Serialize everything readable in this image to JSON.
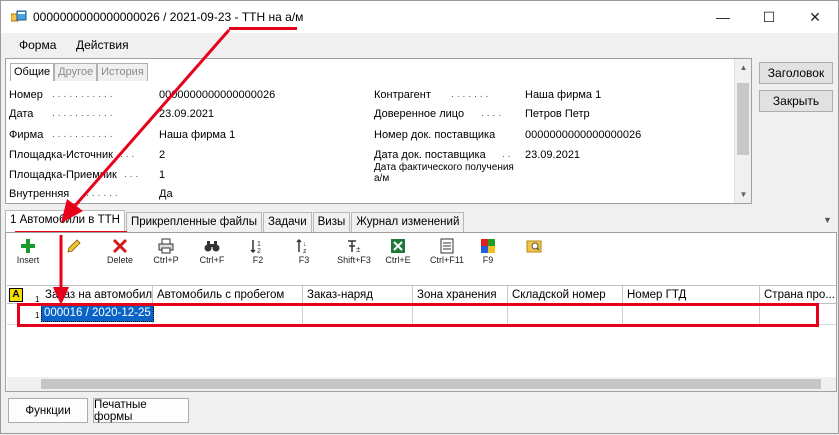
{
  "window": {
    "title": "0000000000000000026 / 2021-09-23 - ТТН на а/м",
    "minimize": "—",
    "maximize": "☐",
    "close": "✕"
  },
  "menu": {
    "items": [
      "Форма",
      "Действия"
    ]
  },
  "header_tabs": [
    "Общие",
    "Другое",
    "История"
  ],
  "fields_left": [
    {
      "label": "Номер",
      "value": "0000000000000000026"
    },
    {
      "label": "Дата",
      "value": "23.09.2021"
    },
    {
      "label": "Фирма",
      "value": "Наша фирма 1"
    },
    {
      "label": "Площадка-Источник",
      "value": "2"
    },
    {
      "label": "Площадка-Приемник",
      "value": "1"
    },
    {
      "label": "Внутренняя",
      "value": "Да"
    }
  ],
  "fields_right": [
    {
      "label": "Контрагент",
      "value": "Наша фирма 1"
    },
    {
      "label": "Доверенное лицо",
      "value": "Петров Петр"
    },
    {
      "label": "Номер док. поставщика",
      "value": "0000000000000000026"
    },
    {
      "label": "Дата док. поставщика",
      "value": "23.09.2021"
    },
    {
      "label": "Дата фактического получения а/м",
      "value": ""
    }
  ],
  "side_buttons": {
    "header": "Заголовок",
    "close": "Закрыть"
  },
  "tabs": [
    "1 Автомобили в ТТН",
    "Прикрепленные файлы",
    "Задачи",
    "Визы",
    "Журнал изменений"
  ],
  "toolbar": [
    {
      "icon": "plus-icon",
      "label": "Insert"
    },
    {
      "icon": "pencil-icon",
      "label": ""
    },
    {
      "icon": "delete-x-icon",
      "label": "Delete"
    },
    {
      "icon": "printer-icon",
      "label": "Ctrl+P"
    },
    {
      "icon": "binoculars-icon",
      "label": "Ctrl+F"
    },
    {
      "icon": "sort-icon",
      "label": "F2"
    },
    {
      "icon": "sort-desc-icon",
      "label": "F3"
    },
    {
      "icon": "filter-icon",
      "label": "Shift+F3"
    },
    {
      "icon": "excel-icon",
      "label": "Ctrl+E"
    },
    {
      "icon": "document-icon",
      "label": "Ctrl+F11"
    },
    {
      "icon": "color-grid-icon",
      "label": "F9"
    },
    {
      "icon": "search-folder-icon",
      "label": ""
    }
  ],
  "grid": {
    "corner": "A",
    "columns": [
      "Заказ на автомобиль",
      "Автомобиль с пробегом",
      "Заказ-наряд",
      "Зона хранения",
      "Складской номер",
      "Номер ГТД",
      "Страна про..."
    ],
    "header_row_marker": "1",
    "rows": [
      {
        "num": "1",
        "cells": [
          "000016 / 2020-12-25",
          "",
          "",
          "",
          "",
          "",
          ""
        ]
      }
    ]
  },
  "bottom_buttons": {
    "functions": "Функции",
    "print_forms": "Печатные формы"
  },
  "colors": {
    "annotation": "#e8001a",
    "selection": "#0a64c8"
  }
}
